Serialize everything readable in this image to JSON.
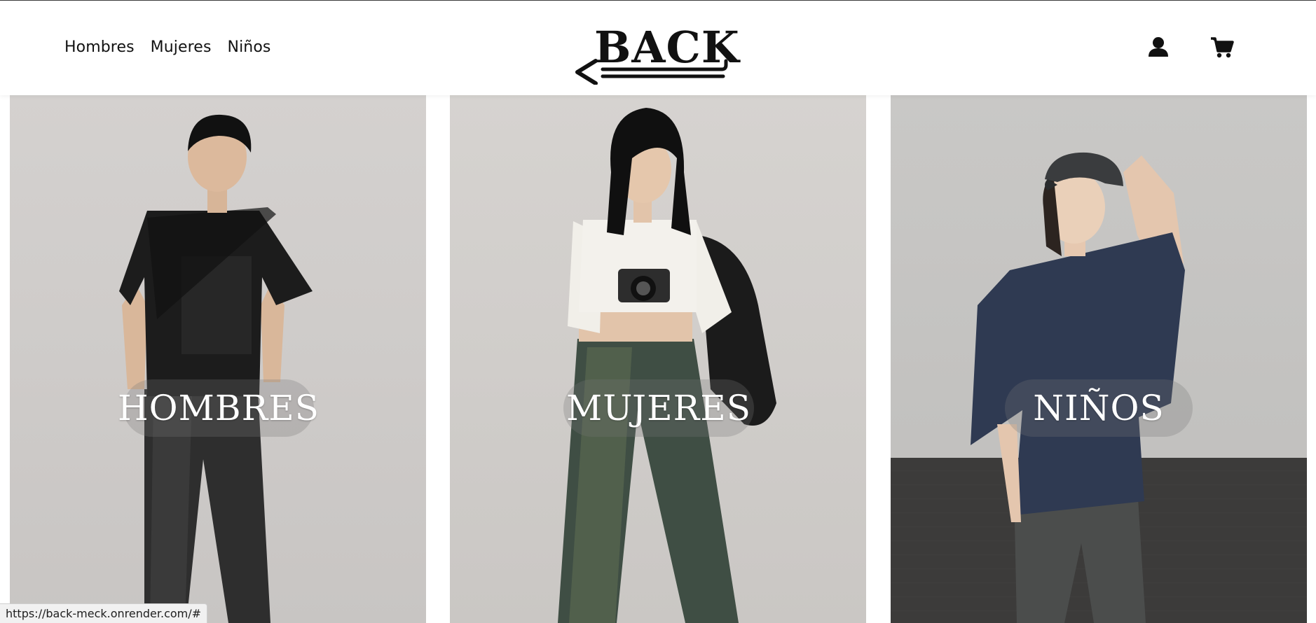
{
  "nav": {
    "items": [
      {
        "label": "Hombres"
      },
      {
        "label": "Mujeres"
      },
      {
        "label": "Niños"
      }
    ]
  },
  "logo": {
    "text": "BACK"
  },
  "header_icons": {
    "account": "user-icon",
    "cart": "cart-icon"
  },
  "categories": [
    {
      "label": "HOMBRES"
    },
    {
      "label": "MUJERES"
    },
    {
      "label": "NIÑOS"
    }
  ],
  "status_bar": {
    "url": "https://back-meck.onrender.com/#"
  },
  "colors": {
    "text": "#111111",
    "header_bg": "#ffffff",
    "label_text": "#ffffff"
  }
}
